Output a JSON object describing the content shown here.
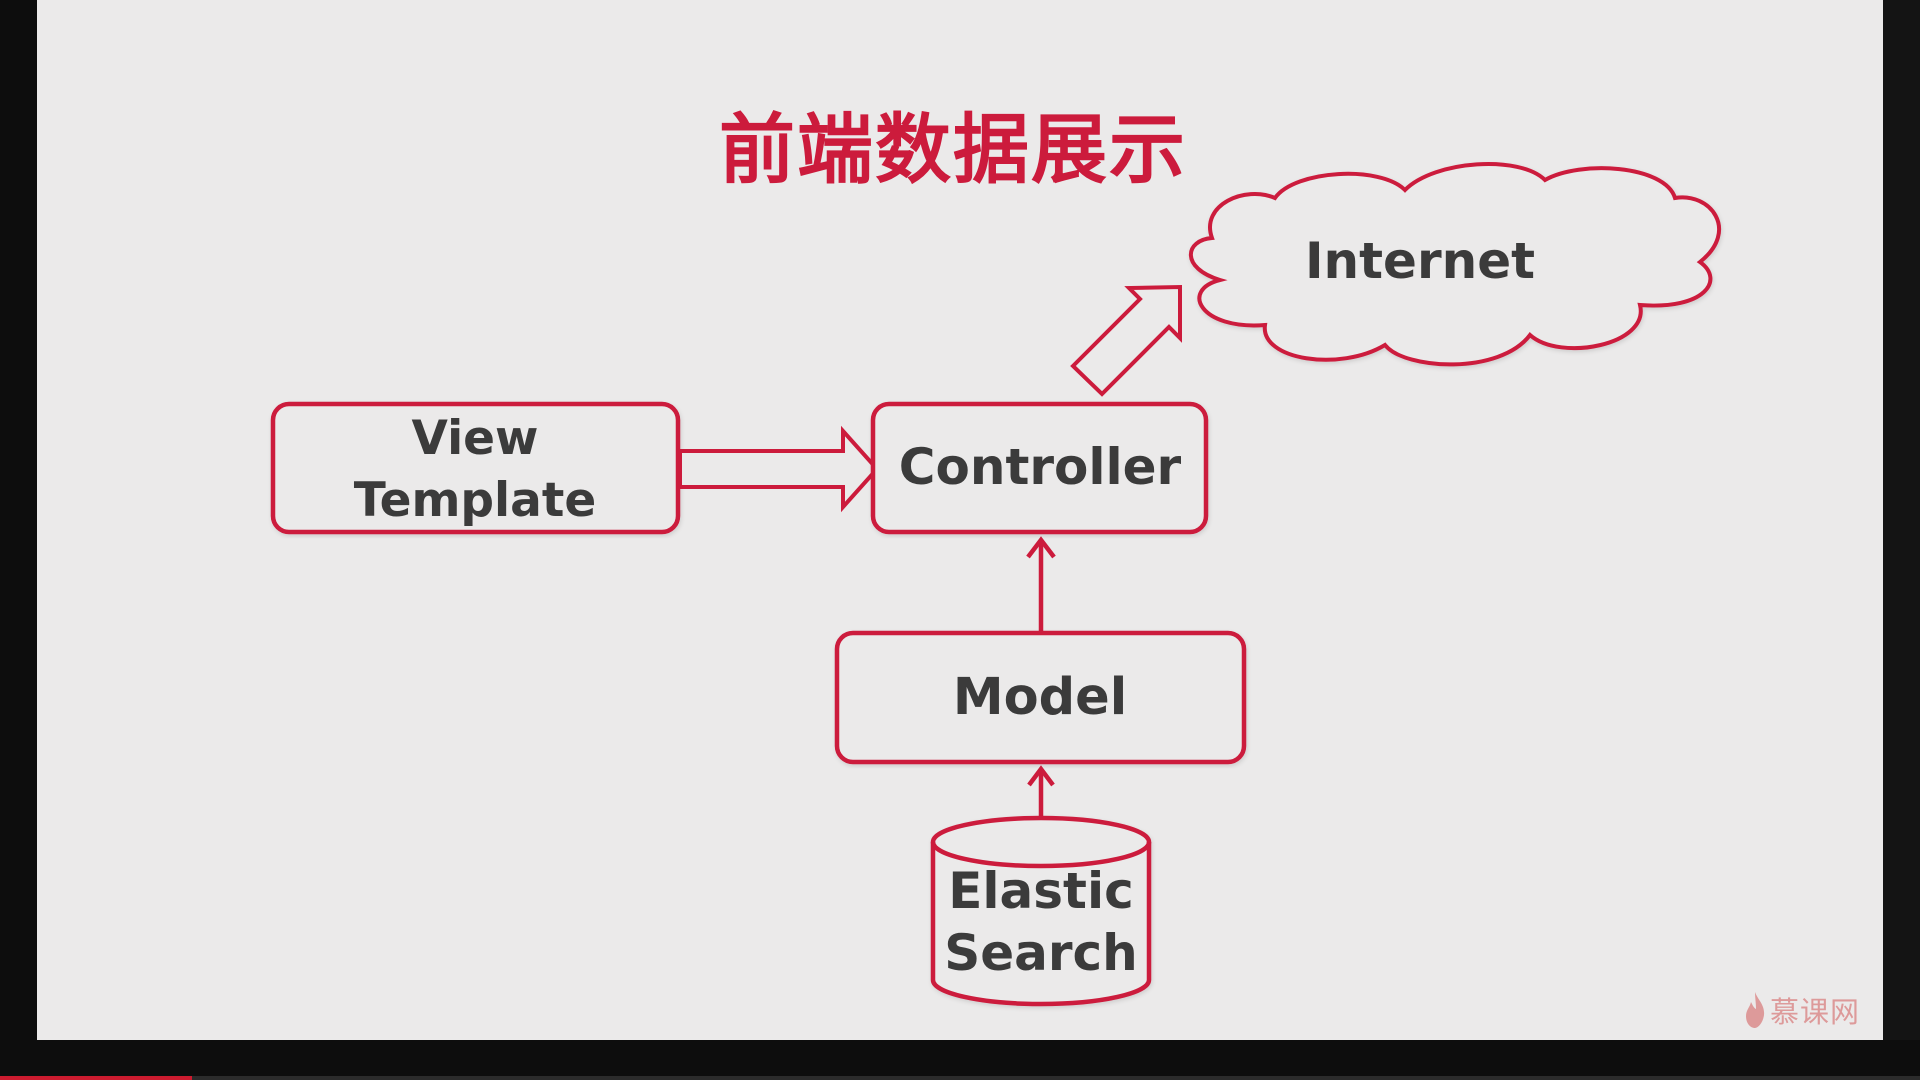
{
  "slide": {
    "title": "前端数据展示"
  },
  "nodes": {
    "view_template": [
      "View",
      "Template"
    ],
    "controller": "Controller",
    "model": "Model",
    "elasticsearch": [
      "Elastic",
      "Search"
    ],
    "internet": "Internet"
  },
  "logo": {
    "text": "慕课网",
    "icon": "flame-icon"
  },
  "video_progress": {
    "fraction": 0.1
  },
  "colors": {
    "accent": "#cc1b3c",
    "node_fill": "#ebeaea",
    "node_text": "#3b3b3b",
    "slide_background": "#ebeaea",
    "frame_background": "#0d0d0d"
  }
}
